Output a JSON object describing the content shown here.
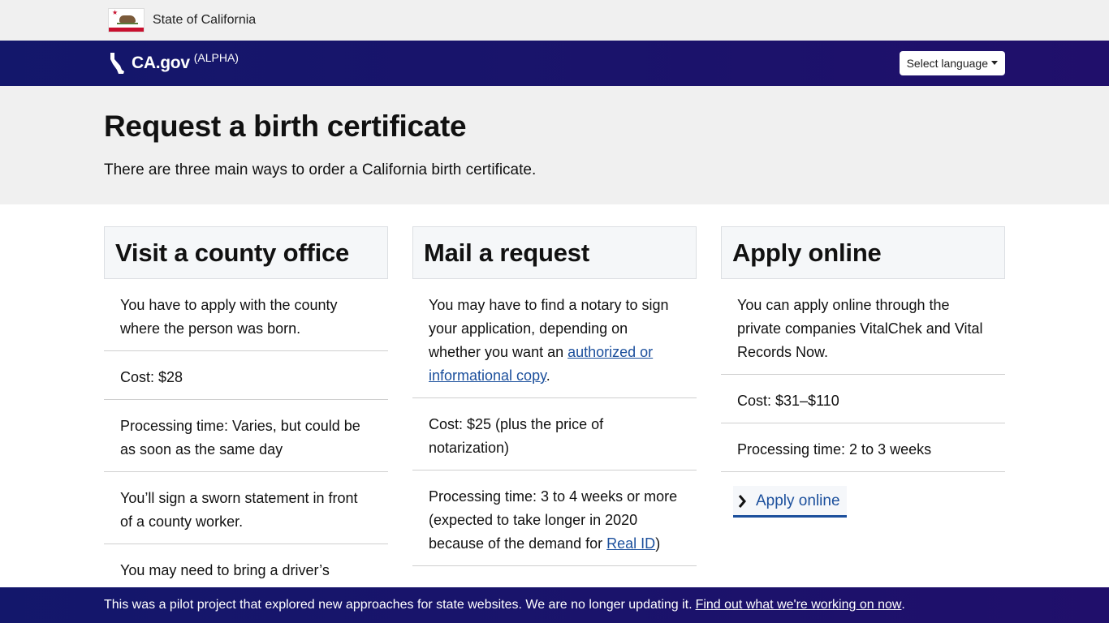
{
  "utility_bar": {
    "state_name": "State of California",
    "flag_icon": "california-flag-icon"
  },
  "header": {
    "brand": "CA.gov",
    "brand_tag": "(ALPHA)",
    "brand_icon": "california-state-icon",
    "language_button": "Select language"
  },
  "hero": {
    "title": "Request a birth certificate",
    "lead": "There are three main ways to order a California birth certificate."
  },
  "cards": [
    {
      "title": "Visit a county office",
      "items": [
        "You have to apply with the county where the person was born.",
        "Cost: $28",
        "Processing time: Varies, but could be as soon as the same day",
        "You’ll sign a sworn statement in front of a county worker.",
        "You may need to bring a driver’s license, passport, or other photo ID"
      ]
    },
    {
      "title": "Mail a request",
      "item1_text": "You may have to find a notary to sign your application, depending on whether you want an ",
      "item1_link": "authorized or informational copy",
      "item1_end": ".",
      "item2": "Cost: $25 (plus the price of notarization)",
      "item3_text": "Processing time: 3 to 4 weeks or more (expected to take longer in 2020 because of the demand for ",
      "item3_link": "Real ID",
      "item3_end": ")"
    },
    {
      "title": "Apply online",
      "items": [
        "You can apply online through the private companies VitalChek and Vital Records Now.",
        "Cost: $31–$110",
        "Processing time: 2 to 3 weeks"
      ],
      "button": "Apply online"
    }
  ],
  "banner": {
    "text": "This was a pilot project that explored new approaches for state websites. We are no longer updating it.",
    "link": "Find out what we're working on now",
    "end": "."
  },
  "colors": {
    "header_navy": "#13176b",
    "header_purple": "#200f6b",
    "link_blue": "#1b4f9c",
    "hero_bg": "#f0f0f0",
    "card_header_bg": "#f5f7f9"
  }
}
